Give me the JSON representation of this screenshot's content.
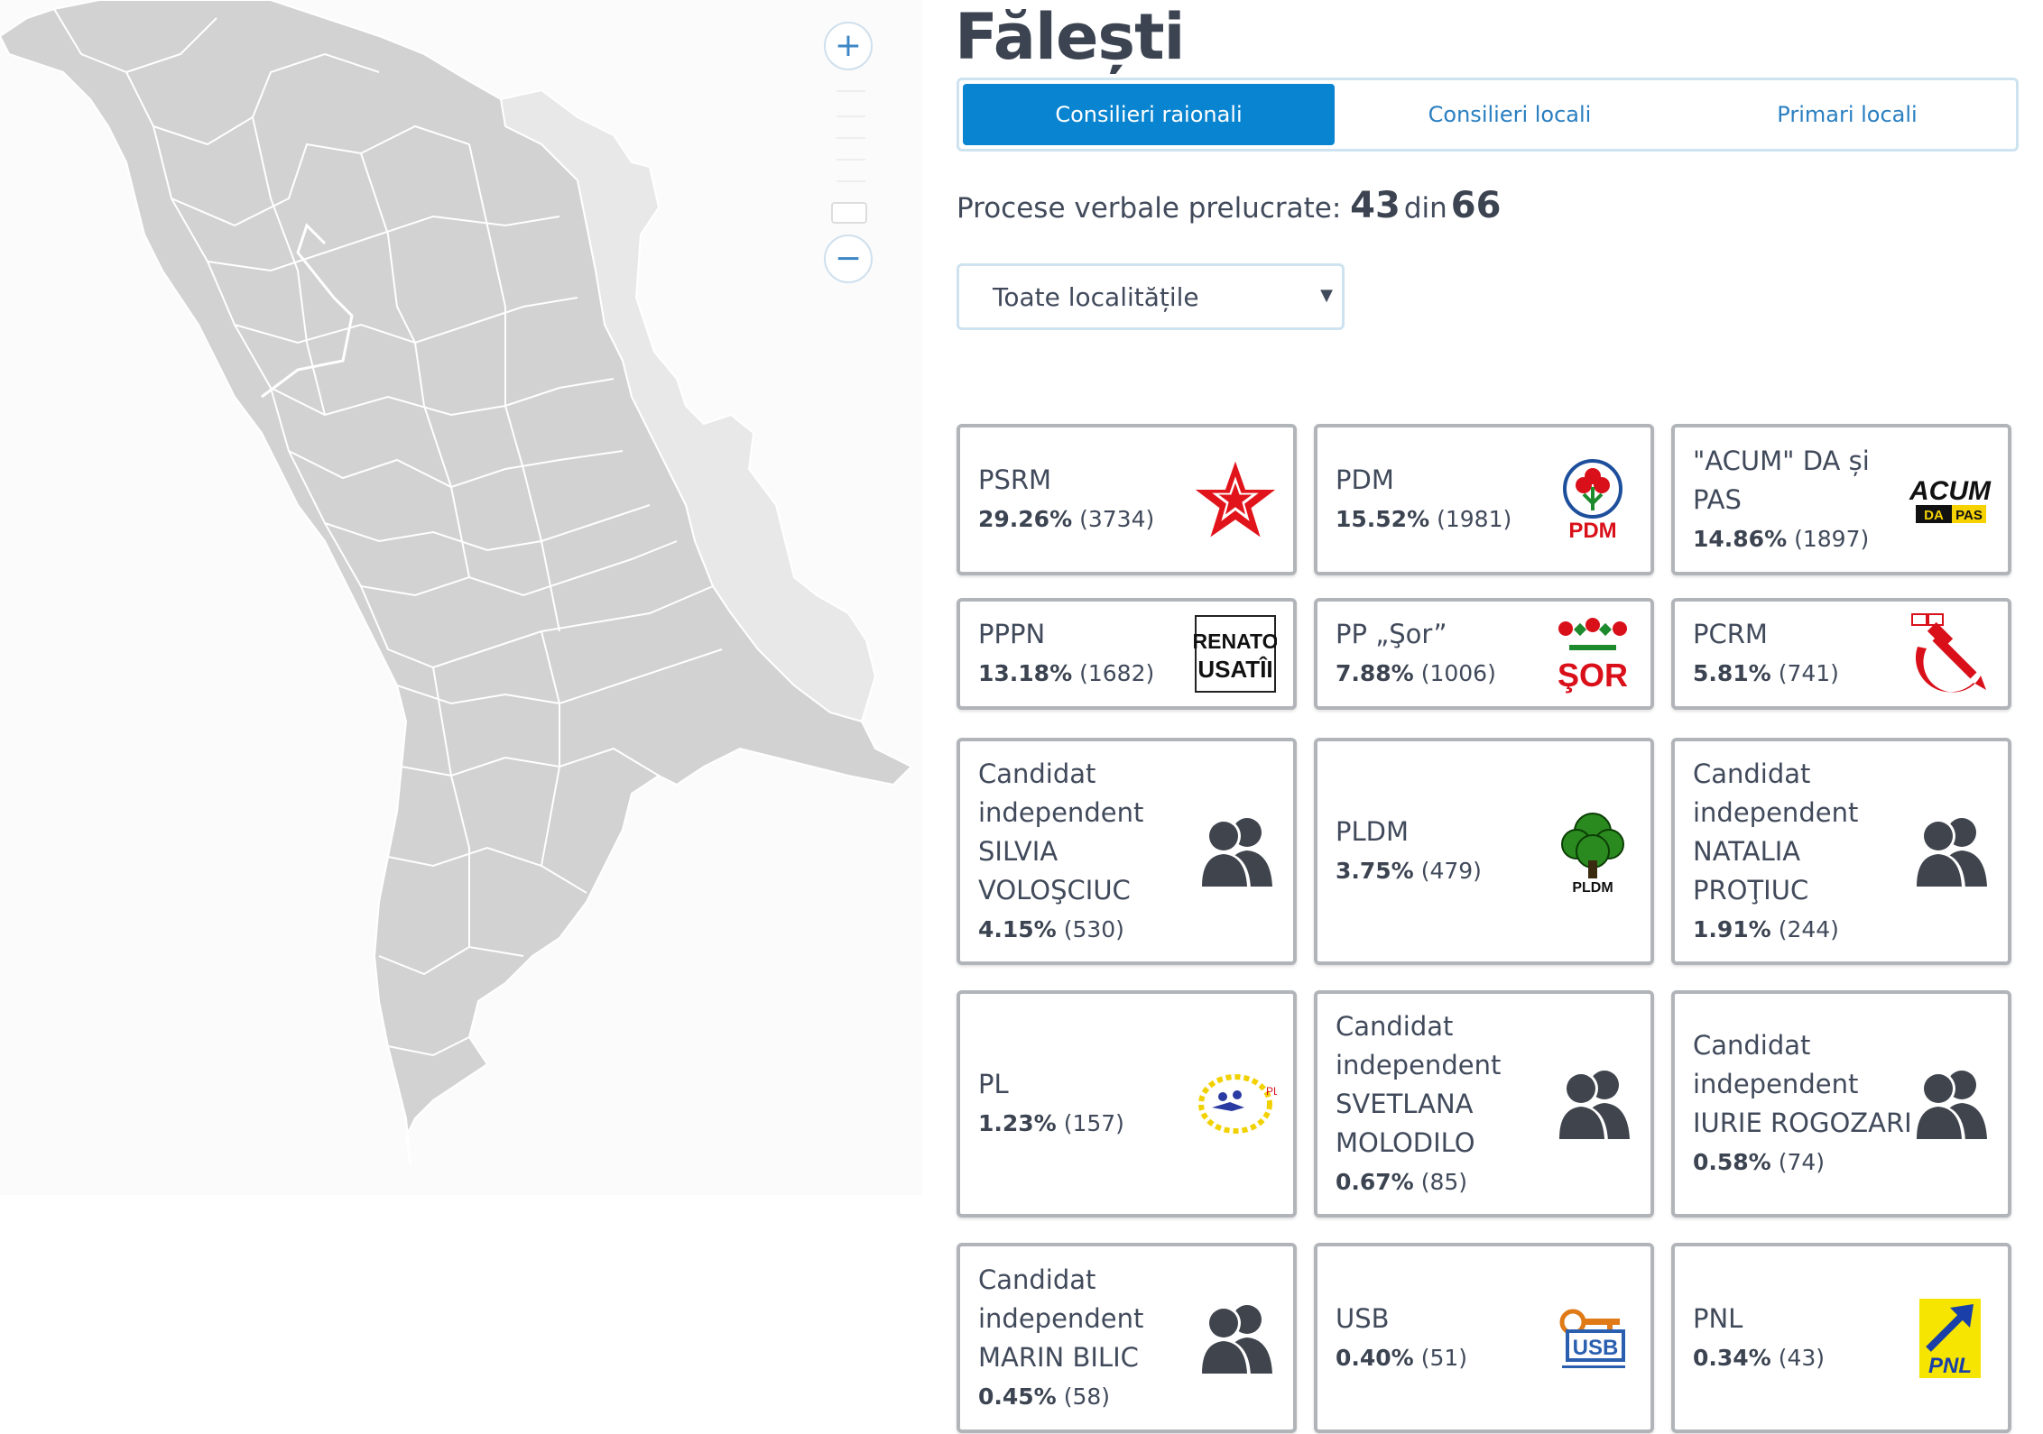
{
  "title": "Fălești",
  "tabs": [
    {
      "label": "Consilieri raionali",
      "active": true
    },
    {
      "label": "Consilieri locali",
      "active": false
    },
    {
      "label": "Primari locali",
      "active": false
    }
  ],
  "processed": {
    "label": "Procese verbale prelucrate:",
    "done": "43",
    "sep": "din",
    "total": "66"
  },
  "locality_select": {
    "selected": "Toate localitățile"
  },
  "map": {
    "zoom_in": "+",
    "zoom_out": "−",
    "region_color": "#d2d2d2",
    "transnistria_color": "#e8e8e8"
  },
  "results": [
    {
      "name": "PSRM",
      "pct": "29.26%",
      "votes": "(3734)",
      "logo": "psrm-star-icon"
    },
    {
      "name": "PDM",
      "pct": "15.52%",
      "votes": "(1981)",
      "logo": "pdm-rose-icon",
      "logo_text": "PDM"
    },
    {
      "name": "\"ACUM\" DA și PAS",
      "pct": "14.86%",
      "votes": "(1897)",
      "logo": "acum-logo",
      "logo_text": "ACUM"
    },
    {
      "name": "PPPN",
      "pct": "13.18%",
      "votes": "(1682)",
      "logo": "renato-usatii-logo",
      "logo_text": "RENATO USATÎI"
    },
    {
      "name": "PP „Şor”",
      "pct": "7.88%",
      "votes": "(1006)",
      "logo": "sor-logo",
      "logo_text": "ŞOR"
    },
    {
      "name": "PCRM",
      "pct": "5.81%",
      "votes": "(741)",
      "logo": "hammer-sickle-icon"
    },
    {
      "name": "Candidat independent SILVIA VOLOŞCIUC",
      "pct": "4.15%",
      "votes": "(530)",
      "logo": "people-icon"
    },
    {
      "name": "PLDM",
      "pct": "3.75%",
      "votes": "(479)",
      "logo": "pldm-tree-icon",
      "logo_text": "PLDM"
    },
    {
      "name": "Candidat independent NATALIA PROŢIUC",
      "pct": "1.91%",
      "votes": "(244)",
      "logo": "people-icon"
    },
    {
      "name": "PL",
      "pct": "1.23%",
      "votes": "(157)",
      "logo": "pl-logo"
    },
    {
      "name": "Candidat independent SVETLANA MOLODILO",
      "pct": "0.67%",
      "votes": "(85)",
      "logo": "people-icon"
    },
    {
      "name": "Candidat independent IURIE ROGOZARI",
      "pct": "0.58%",
      "votes": "(74)",
      "logo": "people-icon"
    },
    {
      "name": "Candidat independent MARIN BILIC",
      "pct": "0.45%",
      "votes": "(58)",
      "logo": "people-icon"
    },
    {
      "name": "USB",
      "pct": "0.40%",
      "votes": "(51)",
      "logo": "usb-key-logo",
      "logo_text": "USB"
    },
    {
      "name": "PNL",
      "pct": "0.34%",
      "votes": "(43)",
      "logo": "pnl-logo",
      "logo_text": "PNL"
    }
  ]
}
